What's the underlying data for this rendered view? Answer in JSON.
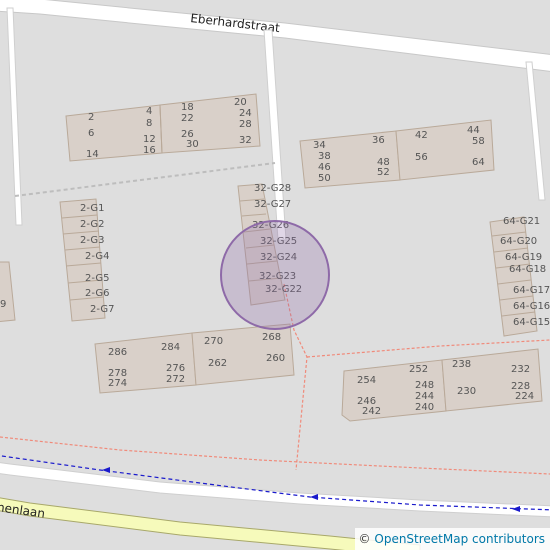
{
  "map": {
    "streets": {
      "north": "Eberhardstraat",
      "south": "ijnenlaan"
    },
    "house_numbers": {
      "block_a": [
        "2",
        "4",
        "6",
        "8",
        "12",
        "14",
        "16",
        "18",
        "20",
        "22",
        "24",
        "26",
        "28",
        "30",
        "32"
      ],
      "block_b": [
        "34",
        "36",
        "38",
        "42",
        "44",
        "46",
        "48",
        "50",
        "52",
        "56",
        "58",
        "64"
      ],
      "g_left": [
        "2-G1",
        "2-G2",
        "2-G3",
        "2-G4",
        "2-G5",
        "2-G6",
        "2-G7"
      ],
      "g_mid": [
        "32-G28",
        "32-G27",
        "32-G26",
        "32-G25",
        "32-G24",
        "32-G23",
        "32-G22"
      ],
      "g_right": [
        "64-G21",
        "64-G20",
        "64-G19",
        "64-G18",
        "64-G17",
        "64-G16",
        "64-G15"
      ],
      "block_c": [
        "268",
        "270",
        "284",
        "286",
        "260",
        "262",
        "276",
        "272",
        "278",
        "274"
      ],
      "block_d": [
        "238",
        "232",
        "252",
        "254",
        "248",
        "244",
        "230",
        "228",
        "224",
        "246",
        "240",
        "242"
      ],
      "edge": "9"
    },
    "marker_color": "#8e6aa8"
  },
  "attribution": {
    "symbol": "©",
    "text": "OpenStreetMap contributors"
  }
}
